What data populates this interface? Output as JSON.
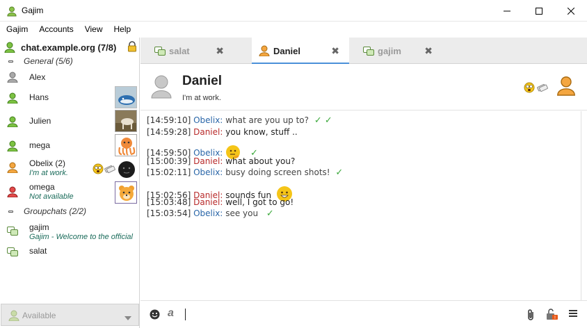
{
  "window": {
    "title": "Gajim"
  },
  "menu": [
    "Gajim",
    "Accounts",
    "View",
    "Help"
  ],
  "roster": {
    "account": "chat.example.org (7/8)",
    "groups": [
      {
        "name": "General (5/6)",
        "contacts": [
          {
            "name": "Alex",
            "status": ""
          },
          {
            "name": "Hans",
            "status": ""
          },
          {
            "name": "Julien",
            "status": ""
          },
          {
            "name": "mega",
            "status": ""
          },
          {
            "name": "Obelix (2)",
            "status": "I'm at work."
          },
          {
            "name": "omega",
            "status": "Not available"
          }
        ]
      },
      {
        "name": "Groupchats (2/2)",
        "contacts": [
          {
            "name": "gajim",
            "status": "Gajim - Welcome to the official"
          },
          {
            "name": "salat",
            "status": ""
          }
        ]
      }
    ],
    "status_selector": "Available"
  },
  "tabs": [
    {
      "label": "salat",
      "close": "✖"
    },
    {
      "label": "Daniel",
      "close": "✖"
    },
    {
      "label": "gajim",
      "close": "✖"
    }
  ],
  "chat": {
    "name": "Daniel",
    "status": "I'm at work.",
    "messages": [
      {
        "ts": "[14:59:10]",
        "nick": "Obelix:",
        "text": "what are you up to?",
        "check": "✓ ✓"
      },
      {
        "ts": "[14:59:28]",
        "nick": "Daniel:",
        "text": "you know, stuff ..",
        "check": ""
      },
      {
        "ts": "[14:59:50]",
        "nick": "Obelix:",
        "text": "",
        "check": "✓"
      },
      {
        "ts": "[15:00:39]",
        "nick": "Daniel:",
        "text": "what about you?",
        "check": ""
      },
      {
        "ts": "[15:02:11]",
        "nick": "Obelix:",
        "text": "busy doing screen shots!",
        "check": "✓"
      },
      {
        "ts": "[15:02:56]",
        "nick": "Daniel:",
        "text": "sounds fun",
        "check": ""
      },
      {
        "ts": "[15:03:48]",
        "nick": "Daniel:",
        "text": "well, I got to go!",
        "check": ""
      },
      {
        "ts": "[15:03:54]",
        "nick": "Obelix:",
        "text": "see you",
        "check": "✓"
      }
    ]
  },
  "colors": {
    "accent": "#4a90d9",
    "online": "#6aae2a",
    "away": "#f0a030",
    "dnd": "#d83a3a"
  }
}
